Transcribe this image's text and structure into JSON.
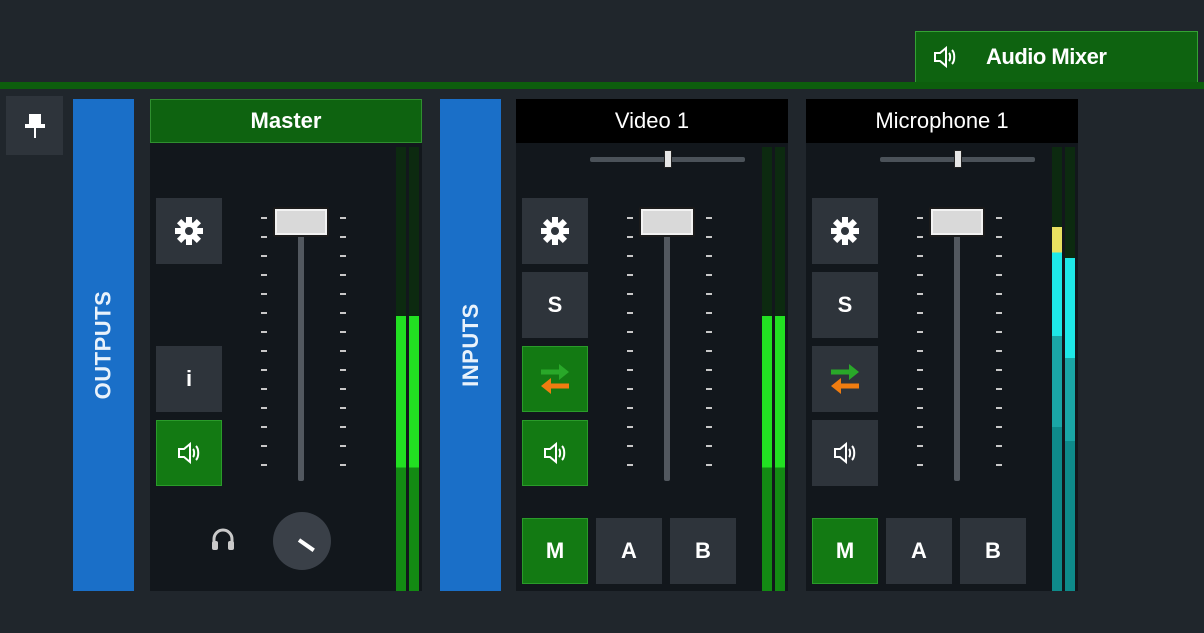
{
  "tab": {
    "label": "Audio Mixer",
    "icon": "speaker-icon"
  },
  "sidebars": {
    "outputs": "OUTPUTS",
    "inputs": "INPUTS"
  },
  "master": {
    "title": "Master",
    "info_label": "i",
    "fader_level": 0.88,
    "meter_levels": [
      0.62,
      0.62
    ]
  },
  "inputs": [
    {
      "title": "Video 1",
      "solo_label": "S",
      "mute_labels": [
        "M",
        "A",
        "B"
      ],
      "active_mute": "M",
      "routing_active": true,
      "speaker_active": true,
      "pan": 0.5,
      "fader_level": 0.88,
      "meter_levels": [
        0.62,
        0.62
      ]
    },
    {
      "title": "Microphone 1",
      "solo_label": "S",
      "mute_labels": [
        "M",
        "A",
        "B"
      ],
      "active_mute": "M",
      "routing_active": false,
      "speaker_active": false,
      "pan": 0.5,
      "fader_level": 0.88,
      "meter_levels": [
        0.82,
        0.75
      ]
    }
  ],
  "colors": {
    "accent_green": "#137a13",
    "sidebar_blue": "#1a6fc8",
    "meter_green": "#22e022",
    "meter_cyan": "#1ee8e8",
    "meter_yellow": "#e8e060",
    "routing_orange": "#f07c10"
  }
}
